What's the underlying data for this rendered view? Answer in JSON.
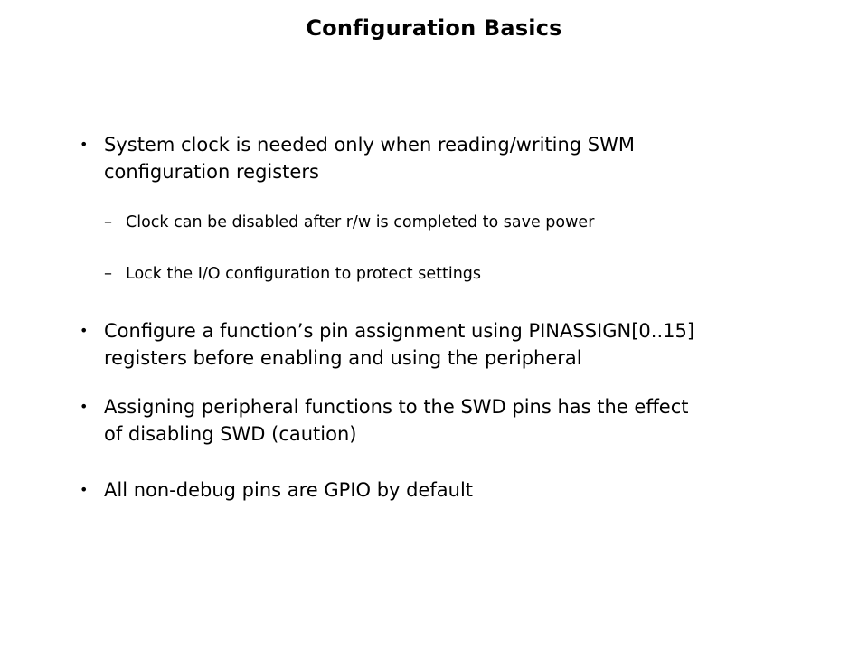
{
  "slide": {
    "title": "Configuration Basics",
    "bullets": [
      {
        "marker": "•",
        "lines": [
          "System clock is needed only when reading/writing SWM",
          "configuration registers"
        ]
      },
      {
        "marker": "–",
        "lines": [
          "Clock can be disabled after r/w is completed to save power"
        ]
      },
      {
        "marker": "–",
        "lines": [
          "Lock the I/O configuration to protect settings"
        ]
      },
      {
        "marker": "•",
        "lines": [
          "Configure a function’s pin assignment using PINASSIGN[0..15]",
          "registers before enabling and using the peripheral"
        ]
      },
      {
        "marker": "•",
        "lines": [
          "Assigning peripheral functions to the SWD pins has the effect",
          "of disabling SWD (caution)"
        ]
      },
      {
        "marker": "•",
        "lines": [
          "All non-debug pins are GPIO by default"
        ]
      }
    ]
  }
}
